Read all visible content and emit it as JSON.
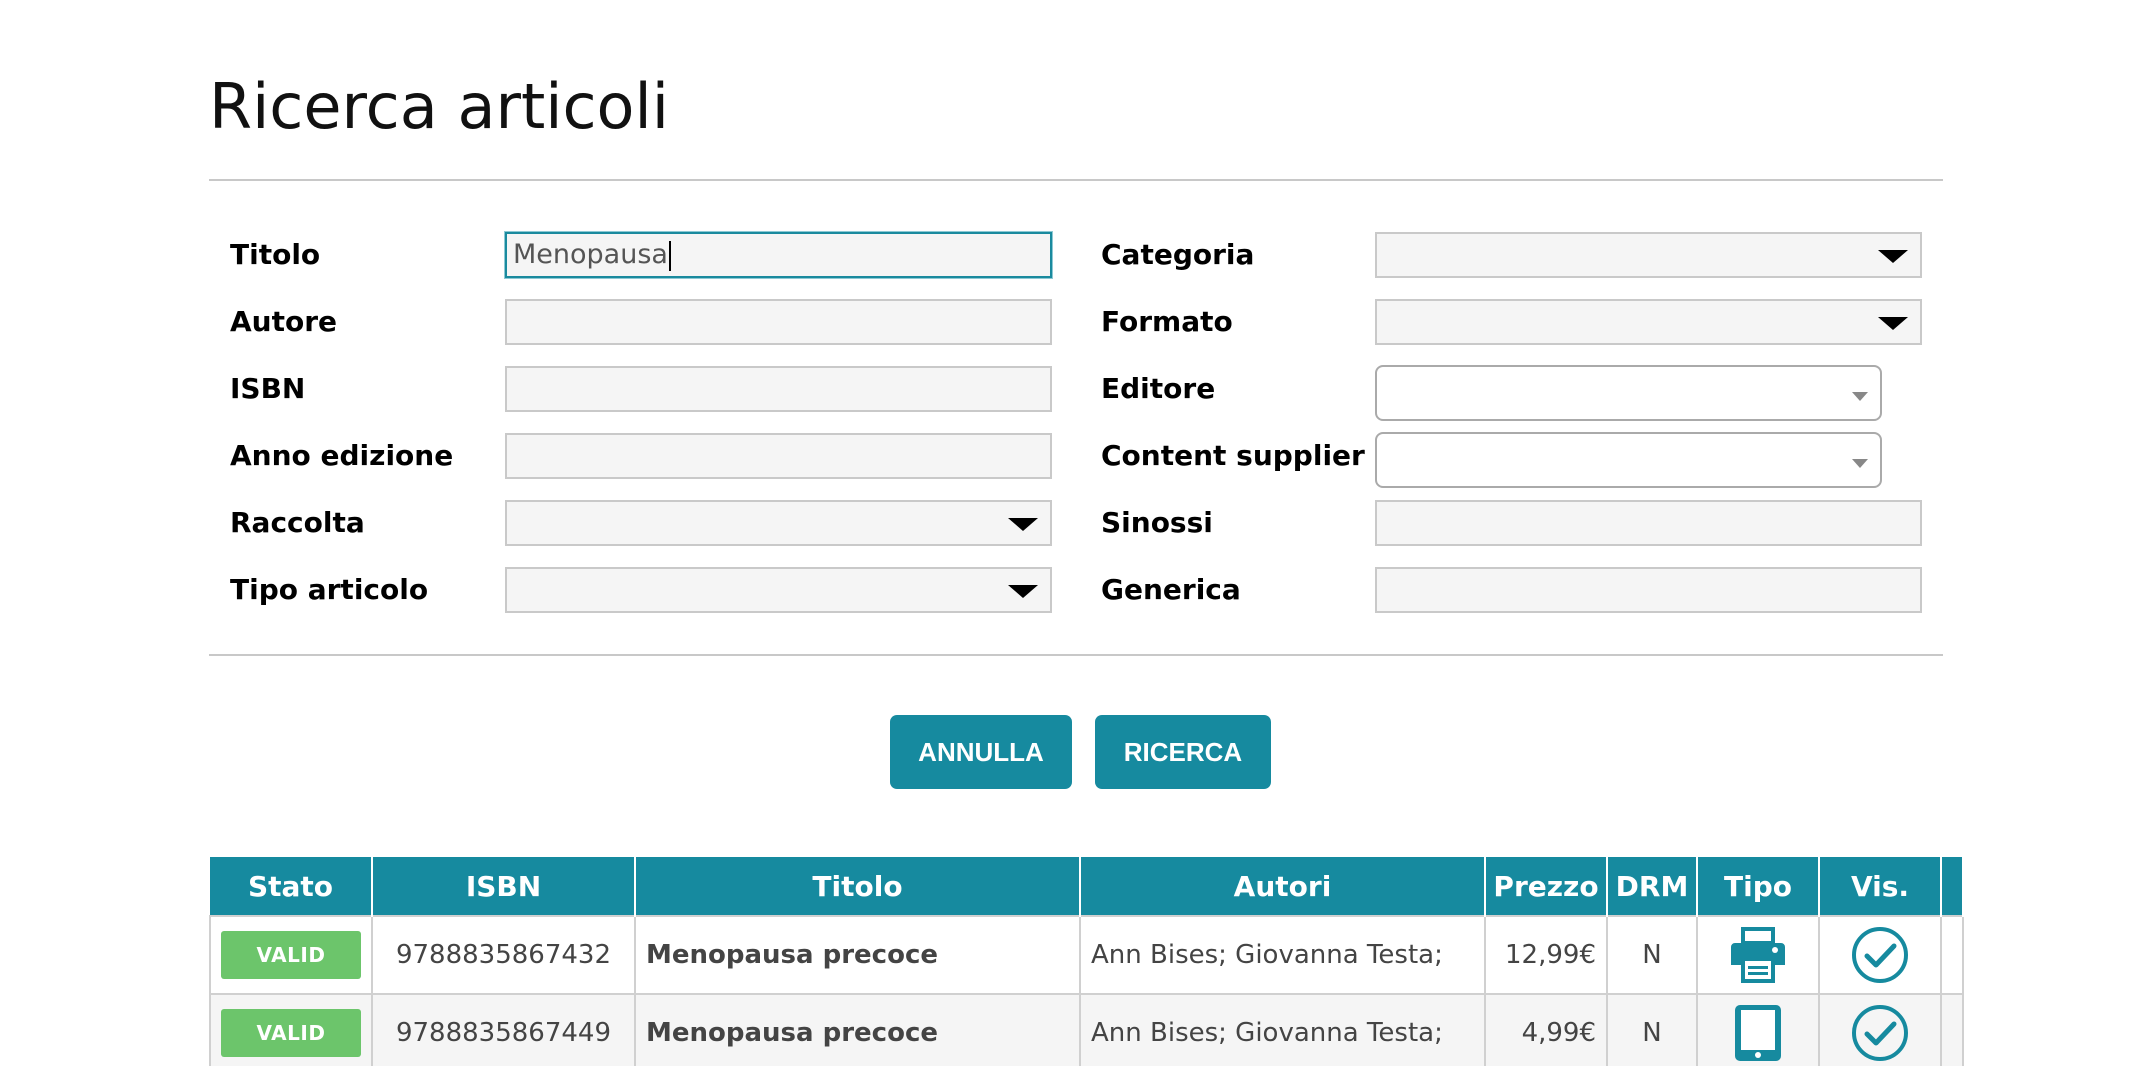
{
  "page": {
    "title": "Ricerca articoli"
  },
  "form": {
    "left": [
      {
        "label": "Titolo",
        "value": "Menopausa",
        "type": "text"
      },
      {
        "label": "Autore",
        "value": "",
        "type": "text"
      },
      {
        "label": "ISBN",
        "value": "",
        "type": "text"
      },
      {
        "label": "Anno edizione",
        "value": "",
        "type": "text"
      },
      {
        "label": "Raccolta",
        "value": "",
        "type": "select"
      },
      {
        "label": "Tipo articolo",
        "value": "",
        "type": "select"
      }
    ],
    "right": [
      {
        "label": "Categoria",
        "value": "",
        "type": "select"
      },
      {
        "label": "Formato",
        "value": "",
        "type": "select"
      },
      {
        "label": "Editore",
        "value": "",
        "type": "combo"
      },
      {
        "label": "Content supplier",
        "value": "",
        "type": "combo"
      },
      {
        "label": "Sinossi",
        "value": "",
        "type": "text"
      },
      {
        "label": "Generica",
        "value": "",
        "type": "text"
      }
    ]
  },
  "buttons": {
    "cancel": "ANNULLA",
    "search": "RICERCA"
  },
  "table": {
    "columns": [
      "Stato",
      "ISBN",
      "Titolo",
      "Autori",
      "Prezzo",
      "DRM",
      "Tipo",
      "Vis."
    ],
    "rows": [
      {
        "status": "VALID",
        "isbn": "9788835867432",
        "title": "Menopausa precoce",
        "authors": "Ann Bises; Giovanna Testa;",
        "price": "12,99€",
        "drm": "N",
        "type_icon": "printer-icon",
        "vis_icon": "check-circle-icon"
      },
      {
        "status": "VALID",
        "isbn": "9788835867449",
        "title": "Menopausa precoce",
        "authors": "Ann Bises; Giovanna Testa;",
        "price": "4,99€",
        "drm": "N",
        "type_icon": "tablet-icon",
        "vis_icon": "check-circle-icon"
      }
    ]
  },
  "colors": {
    "accent": "#168a9f",
    "valid_badge": "#6cc56b"
  }
}
